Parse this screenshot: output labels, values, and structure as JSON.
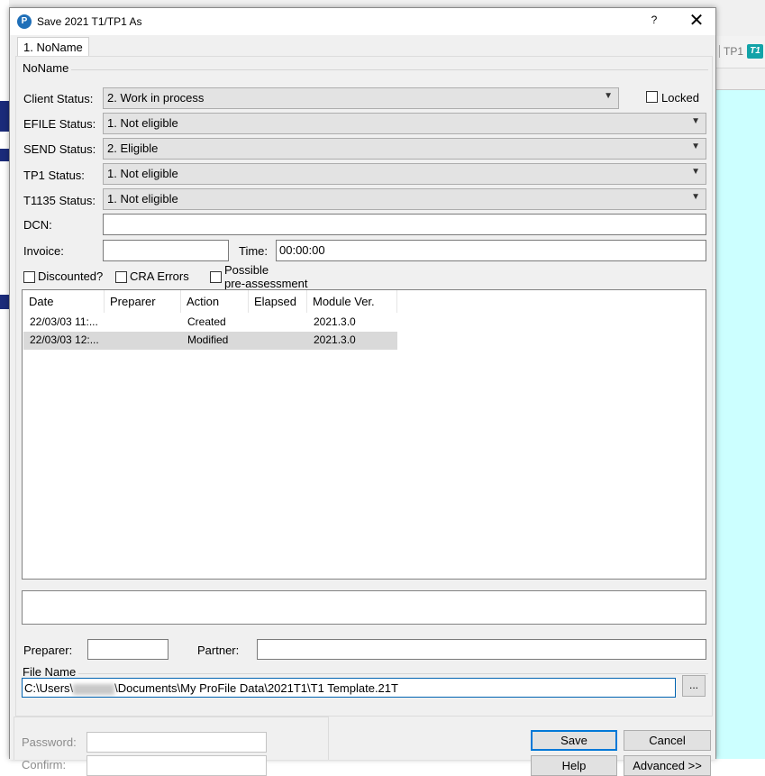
{
  "background_app": {
    "tab_tp1": "TP1",
    "tab_t1": "T1",
    "colors": {
      "workspace": "#ccffff",
      "accent": "#1b2b7a",
      "t1_badge": "#12a3a8"
    }
  },
  "dialog": {
    "title": "Save 2021 T1/TP1 As",
    "help_label": "?",
    "close_label": "✕",
    "tab_label": "1. NoName",
    "group_title": "NoName",
    "client_status": {
      "label": "Client Status:",
      "value": "2. Work in process"
    },
    "locked": {
      "label": "Locked",
      "checked": false
    },
    "efile_status": {
      "label": "EFILE Status:",
      "value": "1. Not eligible"
    },
    "send_status": {
      "label": "SEND Status:",
      "value": "2. Eligible"
    },
    "tp1_status": {
      "label": "TP1 Status:",
      "value": "1. Not eligible"
    },
    "t1135_status": {
      "label": "T1135 Status:",
      "value": "1. Not eligible"
    },
    "dcn": {
      "label": "DCN:",
      "value": ""
    },
    "invoice": {
      "label": "Invoice:",
      "value": ""
    },
    "time": {
      "label": "Time:",
      "value": "00:00:00"
    },
    "checkboxes": {
      "discounted": {
        "label": "Discounted?",
        "checked": false
      },
      "cra_errors": {
        "label": "CRA Errors",
        "checked": false
      },
      "possible": {
        "label_line1": "Possible",
        "label_line2": "pre-assessment",
        "checked": false
      }
    },
    "history": {
      "columns": [
        "Date",
        "Preparer",
        "Action",
        "Elapsed",
        "Module Ver."
      ],
      "rows": [
        {
          "date": "22/03/03 11:...",
          "preparer": "",
          "action": "Created",
          "elapsed": "",
          "module": "2021.3.0",
          "selected": false
        },
        {
          "date": "22/03/03 12:...",
          "preparer": "",
          "action": "Modified",
          "elapsed": "",
          "module": "2021.3.0",
          "selected": true
        }
      ]
    },
    "notes": "",
    "preparer": {
      "label": "Preparer:",
      "value": ""
    },
    "partner": {
      "label": "Partner:",
      "value": ""
    },
    "file_name": {
      "title": "File Name",
      "path_prefix": "C:\\Users\\",
      "path_suffix": "\\Documents\\My ProFile Data\\2021T1\\T1 Template.21T",
      "browse_label": "..."
    },
    "password": {
      "label": "Password:"
    },
    "confirm": {
      "label": "Confirm:"
    },
    "buttons": {
      "save": "Save",
      "cancel": "Cancel",
      "help": "Help",
      "advanced": "Advanced >>"
    },
    "colors": {
      "focus": "#0078d7",
      "selection": "#d9d9d9"
    }
  }
}
